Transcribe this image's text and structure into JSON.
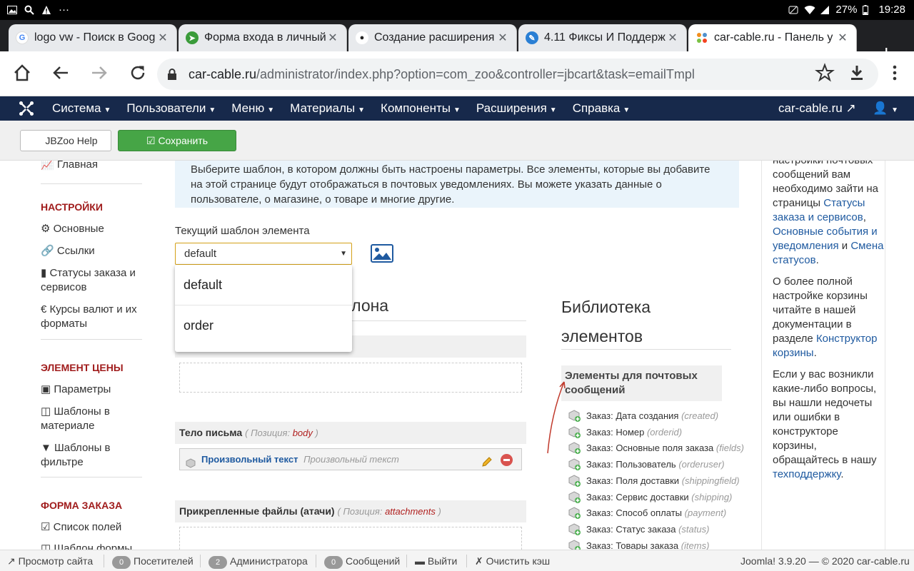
{
  "statusbar": {
    "battery": "27%",
    "time": "19:28"
  },
  "tabs": [
    {
      "title": "logo vw - Поиск в Goog",
      "favicon": "google",
      "color": "#4285f4"
    },
    {
      "title": "Форма входа в личный",
      "favicon": "green-circle",
      "color": "#3a9b3a"
    },
    {
      "title": "Создание расширения",
      "favicon": "penguin",
      "color": "#222222"
    },
    {
      "title": "4.11 Фиксы И Поддерж",
      "favicon": "feather",
      "color": "#2a7fd4"
    },
    {
      "title": "car-cable.ru - Панель у",
      "favicon": "joomla",
      "color": "#f28e1e"
    }
  ],
  "omnibox": {
    "host": "car-cable.ru",
    "path": "/administrator/index.php?option=com_zoo&controller=jbcart&task=emailTmpl"
  },
  "jnav": {
    "menu": [
      "Система",
      "Пользователи",
      "Меню",
      "Материалы",
      "Компоненты",
      "Расширения",
      "Справка"
    ],
    "site": "car-cable.ru"
  },
  "jtool": {
    "help": "JBZoo Help",
    "save": "Сохранить"
  },
  "sidebar": {
    "main": "Главная",
    "sections": [
      {
        "head": "НАСТРОЙКИ",
        "items": [
          "Основные",
          "Ссылки",
          "Статусы заказа и сервисов",
          "€ Курсы валют и их форматы"
        ]
      },
      {
        "head": "ЭЛЕМЕНТ ЦЕНЫ",
        "items": [
          "Параметры",
          "Шаблоны в материале",
          "Шаблоны в фильтре"
        ]
      },
      {
        "head": "ФОРМА ЗАКАЗА",
        "items": [
          "Список полей",
          "Шаблон формы"
        ]
      }
    ]
  },
  "main": {
    "alert": "Выберите шаблон, в котором должны быть настроены параметры. Все элементы, которые вы добавите на этой странице будут отображаться в почтовых уведомлениях. Вы можете указать данные о пользователе, о магазине, о товаре и многие другие.",
    "template_label": "Текущий шаблон элемента",
    "template_value": "default",
    "options": [
      "default",
      "order"
    ],
    "section_heading_visible": "блона",
    "body_position": {
      "label": "Тело письма",
      "position_label": "Позиция:",
      "position": "body"
    },
    "body_element": {
      "name": "Произвольный текст",
      "desc": "Произвольный текст"
    },
    "attach_position": {
      "label": "Прикрепленные файлы (атачи)",
      "position_label": "Позиция:",
      "position": "attachments"
    }
  },
  "library": {
    "title_line1": "Библиотека",
    "title_line2": "элементов",
    "box": "Элементы для почтовых сообщений",
    "items": [
      {
        "label": "Заказ: Дата создания",
        "alias": "(created)"
      },
      {
        "label": "Заказ: Номер",
        "alias": "(orderid)"
      },
      {
        "label": "Заказ: Основные поля заказа",
        "alias": "(fields)"
      },
      {
        "label": "Заказ: Пользователь",
        "alias": "(orderuser)"
      },
      {
        "label": "Заказ: Поля доставки",
        "alias": "(shippingfield)"
      },
      {
        "label": "Заказ: Сервис доставки",
        "alias": "(shipping)"
      },
      {
        "label": "Заказ: Способ оплаты",
        "alias": "(payment)"
      },
      {
        "label": "Заказ: Статус заказа",
        "alias": "(status)"
      },
      {
        "label": "Заказ: Товары заказа",
        "alias": "(items)"
      }
    ]
  },
  "aside": {
    "p1_text": "настройки почтовых сообщений вам необходимо зайти на страницы",
    "link1": "Статусы заказа и сервисов",
    "link2": "Основные события и уведомления",
    "and": "и",
    "link3": "Смена статусов",
    "p2_text": "О более полной настройке корзины читайте в нашей документации в разделе",
    "link4": "Конструктор корзины",
    "p3_text": "Если у вас возникли какие-либо вопросы, вы нашли недочеты или ошибки в конструкторе корзины, обращайтесь в нашу",
    "link5": "техподдержку"
  },
  "jstatus": {
    "preview": "Просмотр сайта",
    "visitors_count": "0",
    "visitors": "Посетителей",
    "admins_count": "2",
    "admins": "Администратора",
    "messages_count": "0",
    "messages": "Сообщений",
    "logout": "Выйти",
    "clear_cache": "Очистить кэш",
    "version": "Joomla! 3.9.20",
    "copyright": "— © 2020 car-cable.ru"
  },
  "colors": {
    "jnav": "#17294b",
    "save": "#46a546",
    "section_head": "#a01c1c",
    "link": "#1f5aa0"
  }
}
